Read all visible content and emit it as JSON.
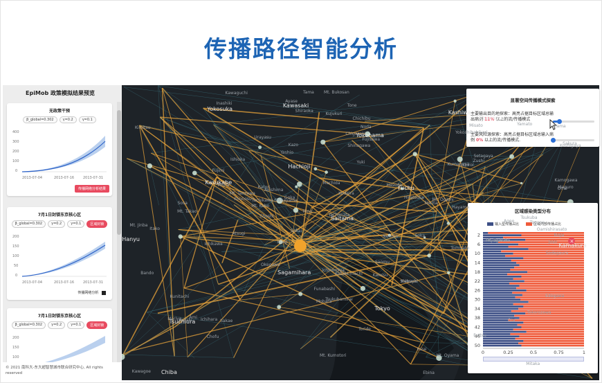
{
  "title": "传播路径智能分析",
  "sidebar": {
    "title": "EpiMob 政策模拟结果预览",
    "cards": [
      {
        "title": "无政策干预",
        "params": [
          "β_global=0.302",
          "γ=0.2",
          "γ=0.1"
        ],
        "badge": "",
        "yticks": [
          "400",
          "300",
          "200",
          "100",
          "0"
        ],
        "xticks": [
          "2013-07-04",
          "2013-07-16",
          "2013-07-31"
        ],
        "button": "传播网络分析结果"
      },
      {
        "title": "7月1日封锁东京核心区",
        "params": [
          "β_global=0.302",
          "γ=0.2",
          "γ=0.1"
        ],
        "badge": "区域封锁",
        "yticks": [
          "200",
          "150",
          "100",
          "50",
          "0"
        ],
        "xticks": [
          "2013-07-04",
          "2013-07-16",
          "2013-07-31"
        ],
        "button": "传播网络分析"
      },
      {
        "title": "7月1日封锁东京核心区",
        "params": [
          "β_global=0.302",
          "γ=0.2",
          "γ=0.1"
        ],
        "badge": "区域封锁",
        "yticks": [
          "200",
          "150",
          "100"
        ],
        "xticks": [],
        "button": ""
      }
    ]
  },
  "footer": "© 2021 南科大-东大超智慧城市联合研究中心, All rights reserved",
  "map": {
    "labels": [
      "Hanyu",
      "Kumagaya",
      "Kazo",
      "Koga",
      "Yuki",
      "Tsuchiura",
      "Tsukuba",
      "Ishioka",
      "Kasukabe",
      "Moriya",
      "Toride",
      "Kashiwa",
      "Noda",
      "Ageo",
      "Saitama",
      "Kawaguchi",
      "Kawagoe",
      "Tokorozawa",
      "Tokyo",
      "Fuchu",
      "Hachioji",
      "Sagamihara",
      "Kawasaki",
      "Yokohama",
      "Machida",
      "Yokosuka",
      "Kamakura",
      "Chiba",
      "Funabashi",
      "Ichikawa",
      "Sakura",
      "Narita",
      "Mobara",
      "Ichihara",
      "Kisarazu",
      "Kimitsu",
      "Hiratsuka",
      "Atsugi",
      "Chichibu",
      "Ome",
      "Shiroi",
      "Inzai",
      "Yachimata",
      "Togane",
      "Kamogawa",
      "Futtsu",
      "Tomisato",
      "Ryugasaki",
      "Katori",
      "Choshi",
      "Kamisu",
      "Itako",
      "Mt. Bukosan",
      "Mt. Ogami",
      "Mt. Kumotori",
      "Mt. Takao",
      "Mt. Kobo",
      "Mt. Tanzawa",
      "Mt. Oyama",
      "Mt. Jinba",
      "Mt. Tsukuba",
      "Sosa",
      "Kozaki",
      "Shiraoka",
      "Hasuda",
      "Kounosu",
      "Okegawa",
      "Fujimi",
      "Koshigaya",
      "Soka",
      "Misato",
      "Yashio",
      "Urayasu",
      "Edogawa",
      "Nerima",
      "Kodaira",
      "Tachikawa",
      "Hino",
      "Akishima",
      "Kunitachi",
      "Tama",
      "Inagi",
      "Chofu",
      "Mitaka",
      "Setagaya",
      "Shinagawa",
      "Ota",
      "Meguro",
      "Shibuya",
      "Yamato",
      "Ebina",
      "Zama",
      "Ayase",
      "Fujisawa",
      "Chigasaki",
      "Zushi",
      "Miura",
      "Hayama",
      "Sodegaura",
      "Ichinomiya",
      "Oamishirasato",
      "Kujukuri",
      "Yokoshibahikari",
      "Sanmu",
      "Shibayama",
      "Sakae",
      "Kozaki-machi",
      "Tone",
      "Kawachi",
      "Ami",
      "Inashiki",
      "Tsukubamirai",
      "Joso",
      "Bando",
      "Sakai",
      "Goka"
    ],
    "big_labels": [
      "Hanyu",
      "Kasukabe",
      "Kashiwa",
      "Saitama",
      "Tokyo",
      "Hachioji",
      "Fuchu",
      "Sagamihara",
      "Kawasaki",
      "Yokohama",
      "Chiba",
      "Kamakura",
      "Yokosuka",
      "Tsuchiura",
      "Kisarazu"
    ]
  },
  "explore_panel": {
    "title": "显著空间传播模式探索",
    "text1_pre": "主要输出目的地探索：高亮占据目标区域总输出病例",
    "text1_value": "11%",
    "text1_post": "以上的流/传播模式",
    "text2_pre": "主要风险源探索：高亮占据目标区域总输入病例",
    "text2_value": "0%",
    "text2_post": "以上的流/传播模式.",
    "slider1": 0.11,
    "slider2": 0.0
  },
  "dist_panel": {
    "title": "区域感染类型分布",
    "legend": [
      "输入型传播占比",
      "区域内部传播占比"
    ],
    "colors": {
      "input": "#3d4f86",
      "internal": "#ef5b3b"
    },
    "xticks": [
      "0",
      "0.25",
      "0.5",
      "0.75",
      "1"
    ],
    "yticks": [
      "2",
      "6",
      "10",
      "14",
      "18",
      "22",
      "26",
      "30",
      "34",
      "38",
      "42",
      "46",
      "50"
    ]
  },
  "chart_data": {
    "type": "bar",
    "title": "区域感染类型分布",
    "series": [
      {
        "name": "输入型传播占比",
        "values": [
          0.05,
          0.38,
          0.2,
          0.42,
          0.15,
          0.35,
          0.25,
          0.45,
          0.18,
          0.3,
          0.22,
          0.4,
          0.28,
          0.33,
          0.36,
          0.31,
          0.27,
          0.44,
          0.24,
          0.38,
          0.3,
          0.41,
          0.26,
          0.36,
          0.33,
          0.43,
          0.29,
          0.39,
          0.32,
          0.37,
          0.45,
          0.3,
          0.4,
          0.35,
          0.28,
          0.42,
          0.31,
          0.36,
          0.25,
          0.4,
          0.34,
          0.38,
          0.3,
          0.43,
          0.27,
          0.36,
          0.32,
          0.4,
          0.35,
          0.38
        ]
      },
      {
        "name": "区域内部传播占比",
        "values": [
          0.95,
          0.62,
          0.8,
          0.58,
          0.85,
          0.65,
          0.75,
          0.55,
          0.82,
          0.7,
          0.78,
          0.6,
          0.72,
          0.67,
          0.64,
          0.69,
          0.73,
          0.56,
          0.76,
          0.62,
          0.7,
          0.59,
          0.74,
          0.64,
          0.67,
          0.57,
          0.71,
          0.61,
          0.68,
          0.63,
          0.55,
          0.7,
          0.6,
          0.65,
          0.72,
          0.58,
          0.69,
          0.64,
          0.75,
          0.6,
          0.66,
          0.62,
          0.7,
          0.57,
          0.73,
          0.64,
          0.68,
          0.6,
          0.65,
          0.62
        ]
      }
    ],
    "categories": [
      "1",
      "2",
      "3",
      "4",
      "5",
      "6",
      "7",
      "8",
      "9",
      "10",
      "11",
      "12",
      "13",
      "14",
      "15",
      "16",
      "17",
      "18",
      "19",
      "20",
      "21",
      "22",
      "23",
      "24",
      "25",
      "26",
      "27",
      "28",
      "29",
      "30",
      "31",
      "32",
      "33",
      "34",
      "35",
      "36",
      "37",
      "38",
      "39",
      "40",
      "41",
      "42",
      "43",
      "44",
      "45",
      "46",
      "47",
      "48",
      "49",
      "50"
    ],
    "xlim": [
      0,
      1
    ],
    "orientation": "horizontal",
    "stacked": true
  }
}
